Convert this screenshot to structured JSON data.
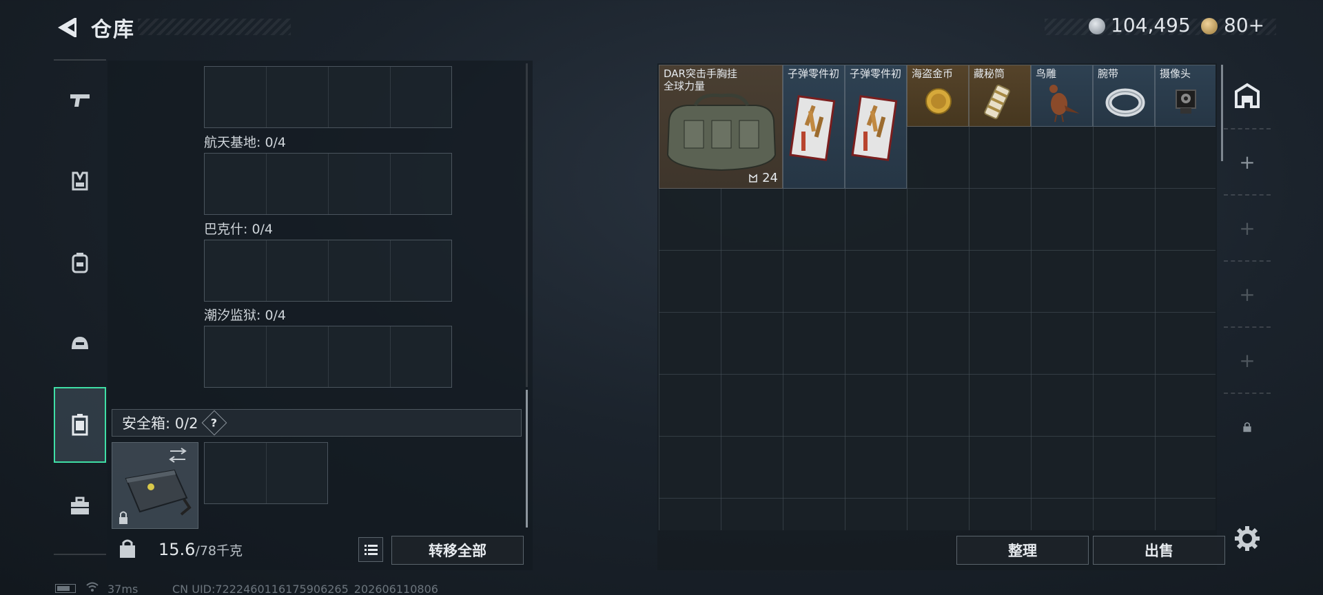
{
  "header": {
    "back_icon": "back-arrow-icon",
    "title": "仓库",
    "currency": {
      "money": "104,495",
      "tokens": "80+"
    }
  },
  "left_tabs": [
    {
      "name": "weapon",
      "icon": "pistol-icon"
    },
    {
      "name": "armor",
      "icon": "vest-icon"
    },
    {
      "name": "backpack",
      "icon": "backpack-icon"
    },
    {
      "name": "helmet",
      "icon": "helmet-icon"
    },
    {
      "name": "container",
      "icon": "container-icon",
      "active": true
    },
    {
      "name": "toolbox",
      "icon": "toolbox-icon"
    }
  ],
  "collections": [
    {
      "label": ""
    },
    {
      "label": "航天基地: 0/4"
    },
    {
      "label": "巴克什: 0/4"
    },
    {
      "label": "潮汐监狱: 0/4"
    }
  ],
  "safe_box": {
    "label": "安全箱: 0/2",
    "help": "?"
  },
  "bottom_left": {
    "weight_value": "15.6",
    "weight_capacity": "/78千克",
    "transfer_all": "转移全部"
  },
  "status": {
    "ping": "37ms",
    "uid": "CN UID:7222460116175906265_202606110806"
  },
  "storage": {
    "items": [
      {
        "name_line1": "DAR突击手胸挂",
        "name_line2": "全球力量",
        "count": "24",
        "tone": "brown"
      },
      {
        "name_line1": "子弹零件初",
        "tone": "blue"
      },
      {
        "name_line1": "子弹零件初",
        "tone": "blue"
      },
      {
        "name_line1": "海盗金币",
        "tone": "gold"
      },
      {
        "name_line1": "藏秘筒",
        "tone": "gold"
      },
      {
        "name_line1": "鸟雕",
        "tone": "blue"
      },
      {
        "name_line1": "腕带",
        "tone": "blue"
      },
      {
        "name_line1": "摄像头",
        "tone": "blue"
      }
    ],
    "sort_label": "整理",
    "sell_label": "出售"
  },
  "right_rail": [
    {
      "icon": "storage-icon"
    },
    {
      "icon": "plus-icon"
    },
    {
      "icon": "plus-icon"
    },
    {
      "icon": "plus-icon"
    },
    {
      "icon": "plus-icon"
    },
    {
      "icon": "lock-icon"
    }
  ],
  "colors": {
    "accent": "#3fe0a6",
    "panel": "#141b21"
  }
}
